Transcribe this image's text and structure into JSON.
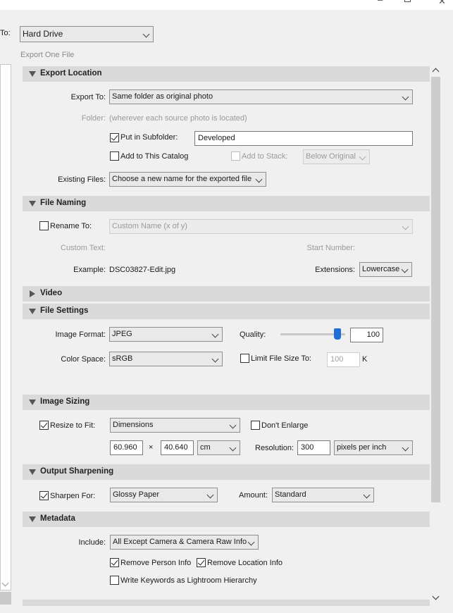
{
  "export_to": {
    "label": "To:",
    "value": "Hard Drive"
  },
  "subtitle": "Export One File",
  "sections": {
    "export_location": "Export Location",
    "file_naming": "File Naming",
    "video": "Video",
    "file_settings": "File Settings",
    "image_sizing": "Image Sizing",
    "output_sharpening": "Output Sharpening",
    "metadata": "Metadata"
  },
  "export_location": {
    "export_to_label": "Export To:",
    "export_to_value": "Same folder as original photo",
    "folder_label": "Folder:",
    "folder_value": "(wherever each source photo is located)",
    "put_in_subfolder_label": "Put in Subfolder:",
    "subfolder_value": "Developed",
    "add_to_catalog_label": "Add to This Catalog",
    "add_to_stack_label": "Add to Stack:",
    "stack_value": "Below Original",
    "existing_files_label": "Existing Files:",
    "existing_files_value": "Choose a new name for the exported file"
  },
  "file_naming": {
    "rename_to_label": "Rename To:",
    "rename_to_value": "Custom Name (x of y)",
    "custom_text_label": "Custom Text:",
    "start_number_label": "Start Number:",
    "example_label": "Example:",
    "example_value": "DSC03827-Edit.jpg",
    "extensions_label": "Extensions:",
    "extensions_value": "Lowercase"
  },
  "file_settings": {
    "image_format_label": "Image Format:",
    "image_format_value": "JPEG",
    "quality_label": "Quality:",
    "quality_value": "100",
    "quality_level": 1.0,
    "color_space_label": "Color Space:",
    "color_space_value": "sRGB",
    "limit_size_label": "Limit File Size To:",
    "limit_size_value": "100",
    "limit_size_unit": "K"
  },
  "image_sizing": {
    "resize_label": "Resize to Fit:",
    "resize_value": "Dimensions",
    "dont_enlarge_label": "Don't Enlarge",
    "width_value": "60.960",
    "times": "×",
    "height_value": "40.640",
    "unit_value": "cm",
    "resolution_label": "Resolution:",
    "resolution_value": "300",
    "resolution_unit": "pixels per inch"
  },
  "output_sharpening": {
    "sharpen_for_label": "Sharpen For:",
    "sharpen_for_value": "Glossy Paper",
    "amount_label": "Amount:",
    "amount_value": "Standard"
  },
  "metadata": {
    "include_label": "Include:",
    "include_value": "All Except Camera & Camera Raw Info",
    "remove_person_label": "Remove Person Info",
    "remove_location_label": "Remove Location Info",
    "write_keywords_label": "Write Keywords as Lightroom Hierarchy"
  },
  "colors": {
    "accent": "#1e6fd9",
    "section_bg": "#dadada",
    "disabled_text": "#9a9a9a"
  }
}
